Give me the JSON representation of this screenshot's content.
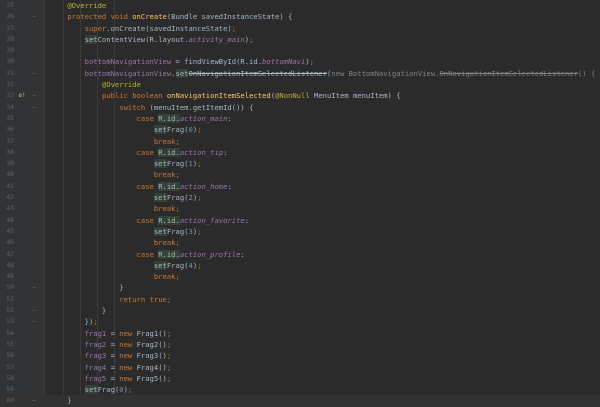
{
  "editor": {
    "lines": [
      {
        "n": "25",
        "mark": "",
        "fold": "",
        "current": false,
        "tokens": [
          {
            "t": "    "
          },
          {
            "t": "@Override",
            "c": "ann"
          }
        ]
      },
      {
        "n": "26",
        "mark": "",
        "fold": "−",
        "current": false,
        "tokens": [
          {
            "t": "    "
          },
          {
            "t": "protected void ",
            "c": "kw"
          },
          {
            "t": "onCreate",
            "c": "fn"
          },
          {
            "t": "(Bundle savedInstanceState) {"
          }
        ]
      },
      {
        "n": "27",
        "mark": "",
        "fold": "",
        "current": false,
        "tokens": [
          {
            "t": "        "
          },
          {
            "t": "super",
            "c": "kw"
          },
          {
            "t": ".onCreate(savedInstanceState)"
          },
          {
            "t": ";",
            "c": "kw"
          }
        ]
      },
      {
        "n": "28",
        "mark": "",
        "fold": "",
        "current": false,
        "tokens": [
          {
            "t": "        "
          },
          {
            "t": "set",
            "c": "hl"
          },
          {
            "t": "ContentView(R.layout."
          },
          {
            "t": "activity_main",
            "c": "ifield"
          },
          {
            "t": ")"
          },
          {
            "t": ";",
            "c": "kw"
          }
        ]
      },
      {
        "n": "29",
        "mark": "",
        "fold": "",
        "current": false,
        "tokens": []
      },
      {
        "n": "30",
        "mark": "",
        "fold": "",
        "current": false,
        "tokens": [
          {
            "t": "        "
          },
          {
            "t": "bottomNavigationView",
            "c": "field"
          },
          {
            "t": " = findViewById(R.id."
          },
          {
            "t": "bottomNavi",
            "c": "ifield"
          },
          {
            "t": ")"
          },
          {
            "t": ";",
            "c": "kw"
          }
        ]
      },
      {
        "n": "31",
        "mark": "",
        "fold": "−",
        "current": false,
        "tokens": [
          {
            "t": "        "
          },
          {
            "t": "bottomNavigationView",
            "c": "field"
          },
          {
            "t": "."
          },
          {
            "t": "set",
            "c": "hl"
          },
          {
            "t": "OnNavigationItemSelectedListener",
            "c": "dep"
          },
          {
            "t": "("
          },
          {
            "t": "new BottomNavigationView.",
            "c": "gray"
          },
          {
            "t": "OnNavigationItemSelectedListener",
            "c": "graydep"
          },
          {
            "t": "() {",
            "c": "gray"
          }
        ]
      },
      {
        "n": "32",
        "mark": "",
        "fold": "",
        "current": false,
        "tokens": [
          {
            "t": "            "
          },
          {
            "t": "@Override",
            "c": "ann"
          }
        ]
      },
      {
        "n": "33",
        "mark": "o!",
        "fold": "−",
        "current": false,
        "tokens": [
          {
            "t": "            "
          },
          {
            "t": "public boolean ",
            "c": "kw"
          },
          {
            "t": "onNavigationItemSelected",
            "c": "fn"
          },
          {
            "t": "("
          },
          {
            "t": "@NonNull",
            "c": "ann"
          },
          {
            "t": " MenuItem menuItem) {"
          }
        ]
      },
      {
        "n": "34",
        "mark": "",
        "fold": "−",
        "current": false,
        "tokens": [
          {
            "t": "                "
          },
          {
            "t": "switch ",
            "c": "kw"
          },
          {
            "t": "(menuItem.getItemId()) {"
          }
        ]
      },
      {
        "n": "35",
        "mark": "",
        "fold": "",
        "current": false,
        "tokens": [
          {
            "t": "                    "
          },
          {
            "t": "case ",
            "c": "kw"
          },
          {
            "t": "R.id.",
            "c": "hl"
          },
          {
            "t": "action_main",
            "c": "ifield"
          },
          {
            "t": ":"
          }
        ]
      },
      {
        "n": "36",
        "mark": "",
        "fold": "",
        "current": false,
        "tokens": [
          {
            "t": "                        "
          },
          {
            "t": "set",
            "c": "hl"
          },
          {
            "t": "Frag("
          },
          {
            "t": "0",
            "c": "num"
          },
          {
            "t": ")"
          },
          {
            "t": ";",
            "c": "kw"
          }
        ]
      },
      {
        "n": "37",
        "mark": "",
        "fold": "",
        "current": false,
        "tokens": [
          {
            "t": "                        "
          },
          {
            "t": "break;",
            "c": "kw"
          }
        ]
      },
      {
        "n": "38",
        "mark": "",
        "fold": "",
        "current": false,
        "tokens": [
          {
            "t": "                    "
          },
          {
            "t": "case ",
            "c": "kw"
          },
          {
            "t": "R.id.",
            "c": "hl"
          },
          {
            "t": "action_tip",
            "c": "ifield"
          },
          {
            "t": ":"
          }
        ]
      },
      {
        "n": "39",
        "mark": "",
        "fold": "",
        "current": false,
        "tokens": [
          {
            "t": "                        "
          },
          {
            "t": "set",
            "c": "hl"
          },
          {
            "t": "Frag("
          },
          {
            "t": "1",
            "c": "num"
          },
          {
            "t": ")"
          },
          {
            "t": ";",
            "c": "kw"
          }
        ]
      },
      {
        "n": "40",
        "mark": "",
        "fold": "",
        "current": false,
        "tokens": [
          {
            "t": "                        "
          },
          {
            "t": "break;",
            "c": "kw"
          }
        ]
      },
      {
        "n": "41",
        "mark": "",
        "fold": "",
        "current": false,
        "tokens": [
          {
            "t": "                    "
          },
          {
            "t": "case ",
            "c": "kw"
          },
          {
            "t": "R.id.",
            "c": "hl"
          },
          {
            "t": "action_home",
            "c": "ifield"
          },
          {
            "t": ":"
          }
        ]
      },
      {
        "n": "42",
        "mark": "",
        "fold": "",
        "current": false,
        "tokens": [
          {
            "t": "                        "
          },
          {
            "t": "set",
            "c": "hl"
          },
          {
            "t": "Frag("
          },
          {
            "t": "2",
            "c": "num"
          },
          {
            "t": ")"
          },
          {
            "t": ";",
            "c": "kw"
          }
        ]
      },
      {
        "n": "43",
        "mark": "",
        "fold": "",
        "current": false,
        "tokens": [
          {
            "t": "                        "
          },
          {
            "t": "break;",
            "c": "kw"
          }
        ]
      },
      {
        "n": "44",
        "mark": "",
        "fold": "",
        "current": false,
        "tokens": [
          {
            "t": "                    "
          },
          {
            "t": "case ",
            "c": "kw"
          },
          {
            "t": "R.id.",
            "c": "hl"
          },
          {
            "t": "action_favorite",
            "c": "ifield"
          },
          {
            "t": ":"
          }
        ]
      },
      {
        "n": "45",
        "mark": "",
        "fold": "",
        "current": false,
        "tokens": [
          {
            "t": "                        "
          },
          {
            "t": "set",
            "c": "hl"
          },
          {
            "t": "Frag("
          },
          {
            "t": "3",
            "c": "num"
          },
          {
            "t": ")"
          },
          {
            "t": ";",
            "c": "kw"
          }
        ]
      },
      {
        "n": "46",
        "mark": "",
        "fold": "",
        "current": false,
        "tokens": [
          {
            "t": "                        "
          },
          {
            "t": "break;",
            "c": "kw"
          }
        ]
      },
      {
        "n": "47",
        "mark": "",
        "fold": "",
        "current": false,
        "tokens": [
          {
            "t": "                    "
          },
          {
            "t": "case ",
            "c": "kw"
          },
          {
            "t": "R.id.",
            "c": "hl"
          },
          {
            "t": "action_profile",
            "c": "ifield"
          },
          {
            "t": ":"
          }
        ]
      },
      {
        "n": "48",
        "mark": "",
        "fold": "",
        "current": false,
        "tokens": [
          {
            "t": "                        "
          },
          {
            "t": "set",
            "c": "hl"
          },
          {
            "t": "Frag("
          },
          {
            "t": "4",
            "c": "num"
          },
          {
            "t": ")"
          },
          {
            "t": ";",
            "c": "kw"
          }
        ]
      },
      {
        "n": "49",
        "mark": "",
        "fold": "",
        "current": false,
        "tokens": [
          {
            "t": "                        "
          },
          {
            "t": "break;",
            "c": "kw"
          }
        ]
      },
      {
        "n": "50",
        "mark": "",
        "fold": "−",
        "current": false,
        "tokens": [
          {
            "t": "                }"
          }
        ]
      },
      {
        "n": "51",
        "mark": "",
        "fold": "",
        "current": false,
        "tokens": [
          {
            "t": "                "
          },
          {
            "t": "return true;",
            "c": "kw"
          }
        ]
      },
      {
        "n": "52",
        "mark": "",
        "fold": "−",
        "current": false,
        "tokens": [
          {
            "t": "            }"
          }
        ]
      },
      {
        "n": "53",
        "mark": "",
        "fold": "−",
        "current": false,
        "tokens": [
          {
            "t": "        })"
          },
          {
            "t": ";",
            "c": "kw"
          }
        ]
      },
      {
        "n": "54",
        "mark": "",
        "fold": "",
        "current": false,
        "tokens": [
          {
            "t": "        "
          },
          {
            "t": "frag1",
            "c": "field"
          },
          {
            "t": " = "
          },
          {
            "t": "new ",
            "c": "kw"
          },
          {
            "t": "Frag1()"
          },
          {
            "t": ";",
            "c": "kw"
          }
        ]
      },
      {
        "n": "55",
        "mark": "",
        "fold": "",
        "current": false,
        "tokens": [
          {
            "t": "        "
          },
          {
            "t": "frag2",
            "c": "field"
          },
          {
            "t": " = "
          },
          {
            "t": "new ",
            "c": "kw"
          },
          {
            "t": "Frag2()"
          },
          {
            "t": ";",
            "c": "kw"
          }
        ]
      },
      {
        "n": "56",
        "mark": "",
        "fold": "",
        "current": false,
        "tokens": [
          {
            "t": "        "
          },
          {
            "t": "frag3",
            "c": "field"
          },
          {
            "t": " = "
          },
          {
            "t": "new ",
            "c": "kw"
          },
          {
            "t": "Frag3()"
          },
          {
            "t": ";",
            "c": "kw"
          }
        ]
      },
      {
        "n": "57",
        "mark": "",
        "fold": "",
        "current": false,
        "tokens": [
          {
            "t": "        "
          },
          {
            "t": "frag4",
            "c": "field"
          },
          {
            "t": " = "
          },
          {
            "t": "new ",
            "c": "kw"
          },
          {
            "t": "Frag4()"
          },
          {
            "t": ";",
            "c": "kw"
          }
        ]
      },
      {
        "n": "58",
        "mark": "",
        "fold": "",
        "current": false,
        "tokens": [
          {
            "t": "        "
          },
          {
            "t": "frag5",
            "c": "field"
          },
          {
            "t": " = "
          },
          {
            "t": "new ",
            "c": "kw"
          },
          {
            "t": "Frag5()"
          },
          {
            "t": ";",
            "c": "kw"
          }
        ]
      },
      {
        "n": "59",
        "mark": "",
        "fold": "",
        "current": false,
        "tokens": [
          {
            "t": "        "
          },
          {
            "t": "set",
            "c": "hl"
          },
          {
            "t": "Frag("
          },
          {
            "t": "0",
            "c": "num"
          },
          {
            "t": ")"
          },
          {
            "t": ";",
            "c": "kw"
          }
        ]
      },
      {
        "n": "60",
        "mark": "",
        "fold": "−",
        "current": true,
        "tokens": [
          {
            "t": "    }"
          }
        ]
      }
    ]
  },
  "colors": {
    "background": "#2b2b2b",
    "gutter": "#313335",
    "keyword": "#cc7832",
    "annotation": "#bbb529",
    "method": "#ffc66d",
    "field": "#9876aa",
    "number": "#6897bb",
    "text": "#a9b7c6"
  }
}
